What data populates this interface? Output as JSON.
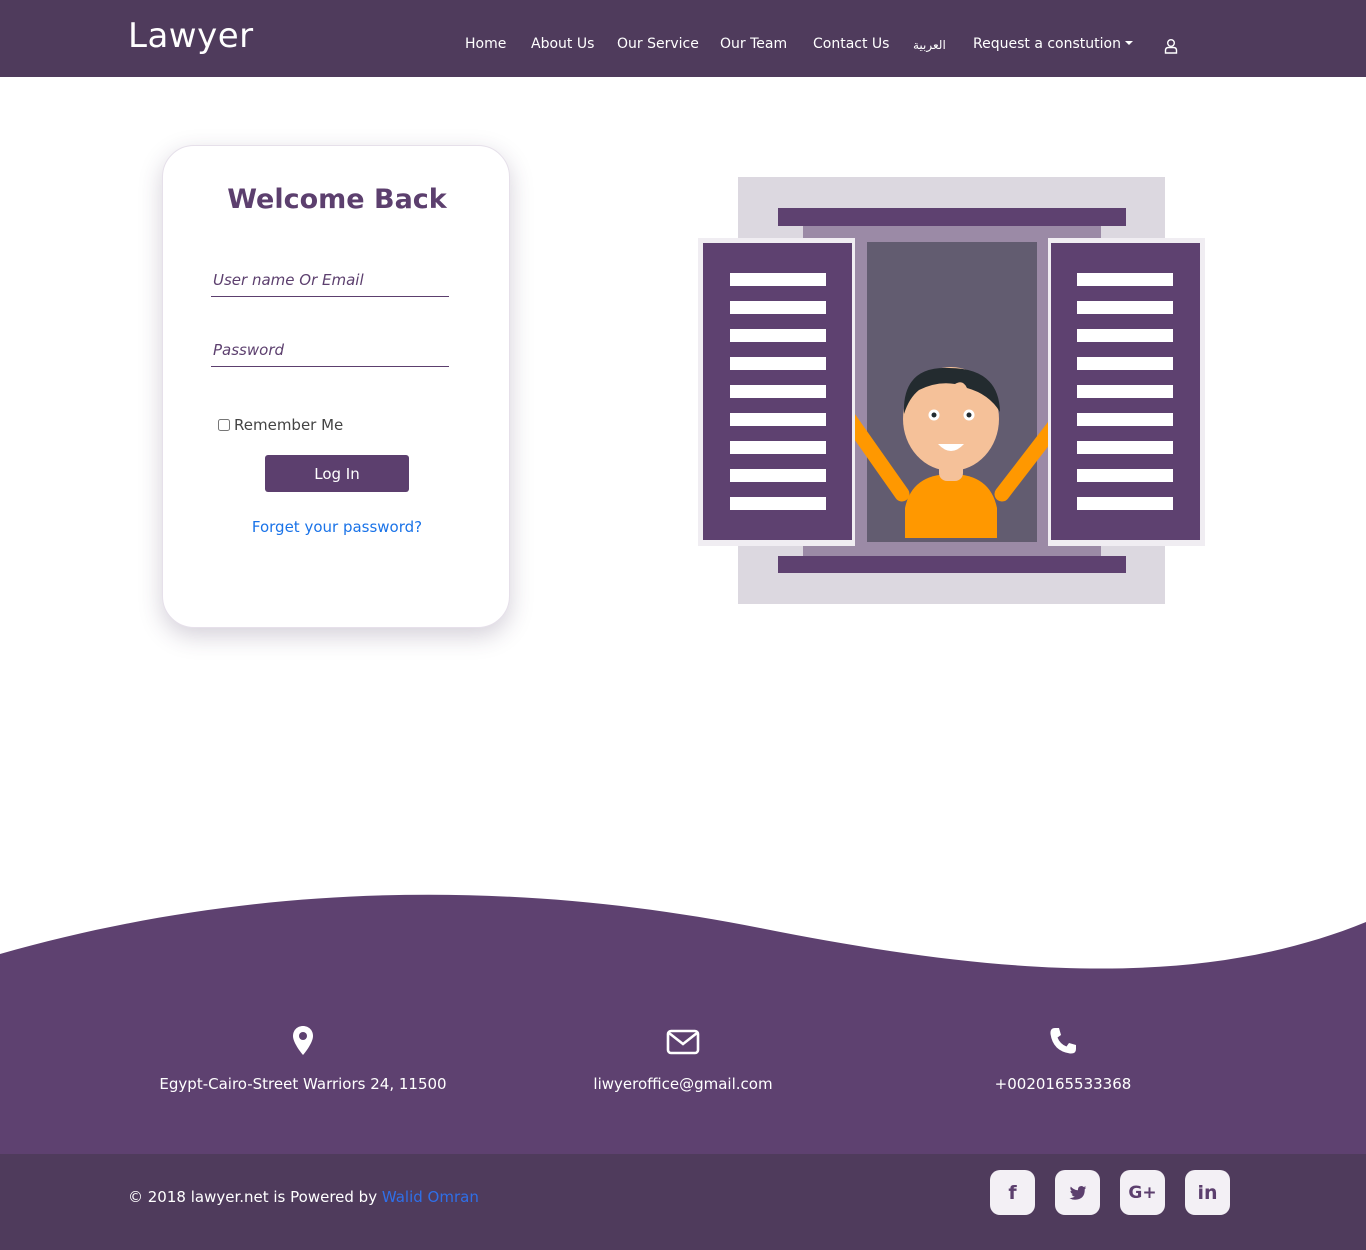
{
  "brand": "Lawyer",
  "nav": {
    "home": "Home",
    "about": "About Us",
    "service": "Our Service",
    "team": "Our Team",
    "contact": "Contact Us",
    "arabic": "العربية",
    "request": "Request a constution"
  },
  "login": {
    "title": "Welcome Back",
    "username_placeholder": "User name Or Email",
    "username_value": "",
    "password_placeholder": "Password",
    "password_value": "",
    "remember": "Remember Me",
    "remember_checked": false,
    "login_button": "Log In",
    "forgot": "Forget your password?"
  },
  "footer": {
    "address": "Egypt-Cairo-Street Warriors 24, 11500",
    "email": "liwyeroffice@gmail.com",
    "phone": "+0020165533368",
    "copyright_prefix": "© 2018 lawyer.net is Powered by",
    "author": "Walid Omran",
    "social": {
      "facebook": "f",
      "google": "G+",
      "linkedin": "in"
    }
  },
  "colors": {
    "primary": "#4f3b5c",
    "accent": "#5c3f6e",
    "footer_bg": "#5e4170",
    "link": "#1a73e8",
    "shirt": "#ff9800"
  }
}
